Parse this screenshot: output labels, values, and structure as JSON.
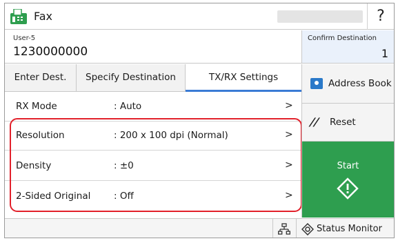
{
  "title_bar": {
    "app_title": "Fax",
    "help_label": "?",
    "fax_icon": "fax-icon",
    "fax_icon_color": "#2e9e4f"
  },
  "destination": {
    "name": "User-5",
    "number": "1230000000",
    "confirm_label": "Confirm Destination",
    "confirm_count": "1"
  },
  "tabs": [
    {
      "label": "Enter Dest."
    },
    {
      "label": "Specify Destination"
    },
    {
      "label": "TX/RX Settings",
      "selected": true
    }
  ],
  "settings": [
    {
      "label": "RX Mode",
      "value": ": Auto",
      "chevron": ">"
    },
    {
      "label": "Resolution",
      "value": ": 200 x 100 dpi (Normal)",
      "chevron": ">"
    },
    {
      "label": "Density",
      "value": ": ±0",
      "chevron": ">"
    },
    {
      "label": "2-Sided Original",
      "value": ": Off",
      "chevron": ">"
    }
  ],
  "actions": {
    "address_book_label": "Address Book",
    "address_book_icon": "address-book-icon",
    "reset_label": "Reset",
    "reset_icon": "reset-icon",
    "start_label": "Start",
    "start_icon": "start-diamond-icon"
  },
  "status_bar": {
    "network_icon": "network-icon",
    "status_monitor_label": "Status Monitor",
    "status_monitor_icon": "status-monitor-icon"
  },
  "colors": {
    "accent_blue": "#3a7bd5",
    "start_green": "#2e9e4f",
    "highlight_red": "#e2202a"
  }
}
